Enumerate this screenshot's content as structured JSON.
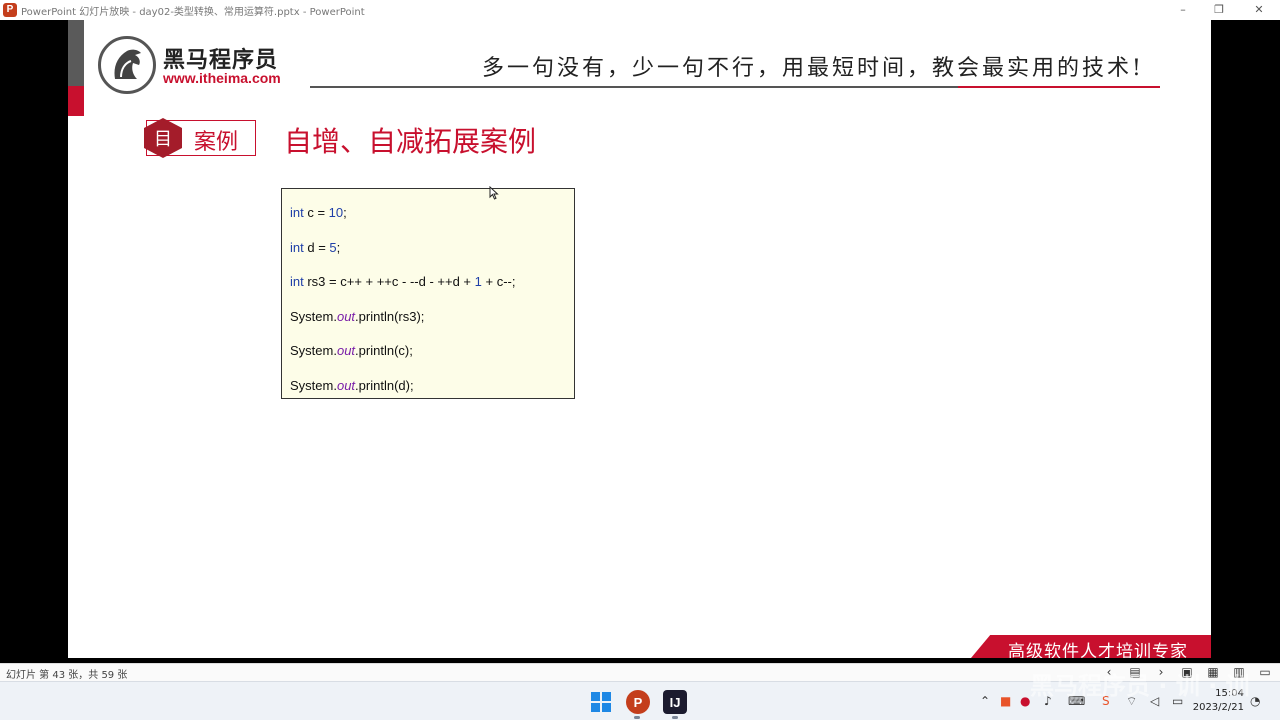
{
  "window": {
    "title": "PowerPoint 幻灯片放映  -  day02-类型转换、常用运算符.pptx - PowerPoint",
    "app_icon": "P",
    "minimize": "–",
    "restore": "❐",
    "close": "✕"
  },
  "slide": {
    "logo_cn": "黑马程序员",
    "logo_url": "www.itheima.com",
    "slogan": "多一句没有，少一句不行，用最短时间，教会最实用的技术!",
    "case_icon": "目",
    "case_label": "案例",
    "case_title": "自增、自减拓展案例",
    "code": {
      "line1": {
        "kw": "int",
        "mid": " c = ",
        "num": "10",
        "end": ";"
      },
      "line2": {
        "kw": "int",
        "mid": " d = ",
        "num": "5",
        "end": ";"
      },
      "line3": {
        "kw": "int",
        "mid": " rs3 = c++ + ++c - --d - ++d + ",
        "num": "1",
        "end": " + c--;"
      },
      "line4": {
        "pre": "System.",
        "field": "out",
        "post": ".println(rs3);"
      },
      "line5": {
        "pre": "System.",
        "field": "out",
        "post": ".println(c);"
      },
      "line6": {
        "pre": "System.",
        "field": "out",
        "post": ".println(d);"
      }
    },
    "footer_tag": "高级软件人才培训专家",
    "colors": {
      "accent": "#c8102e",
      "code_bg": "#fdfde8",
      "keyword": "#1f3fa8",
      "field": "#7a1fa8"
    }
  },
  "statusbar": {
    "slide_counter": "幻灯片 第 43 张，共 59 张"
  },
  "taskbar": {
    "clock_time": "15:04",
    "clock_date": "2023/2/21",
    "watermark": "黑马程序员 · 训 · 训"
  }
}
